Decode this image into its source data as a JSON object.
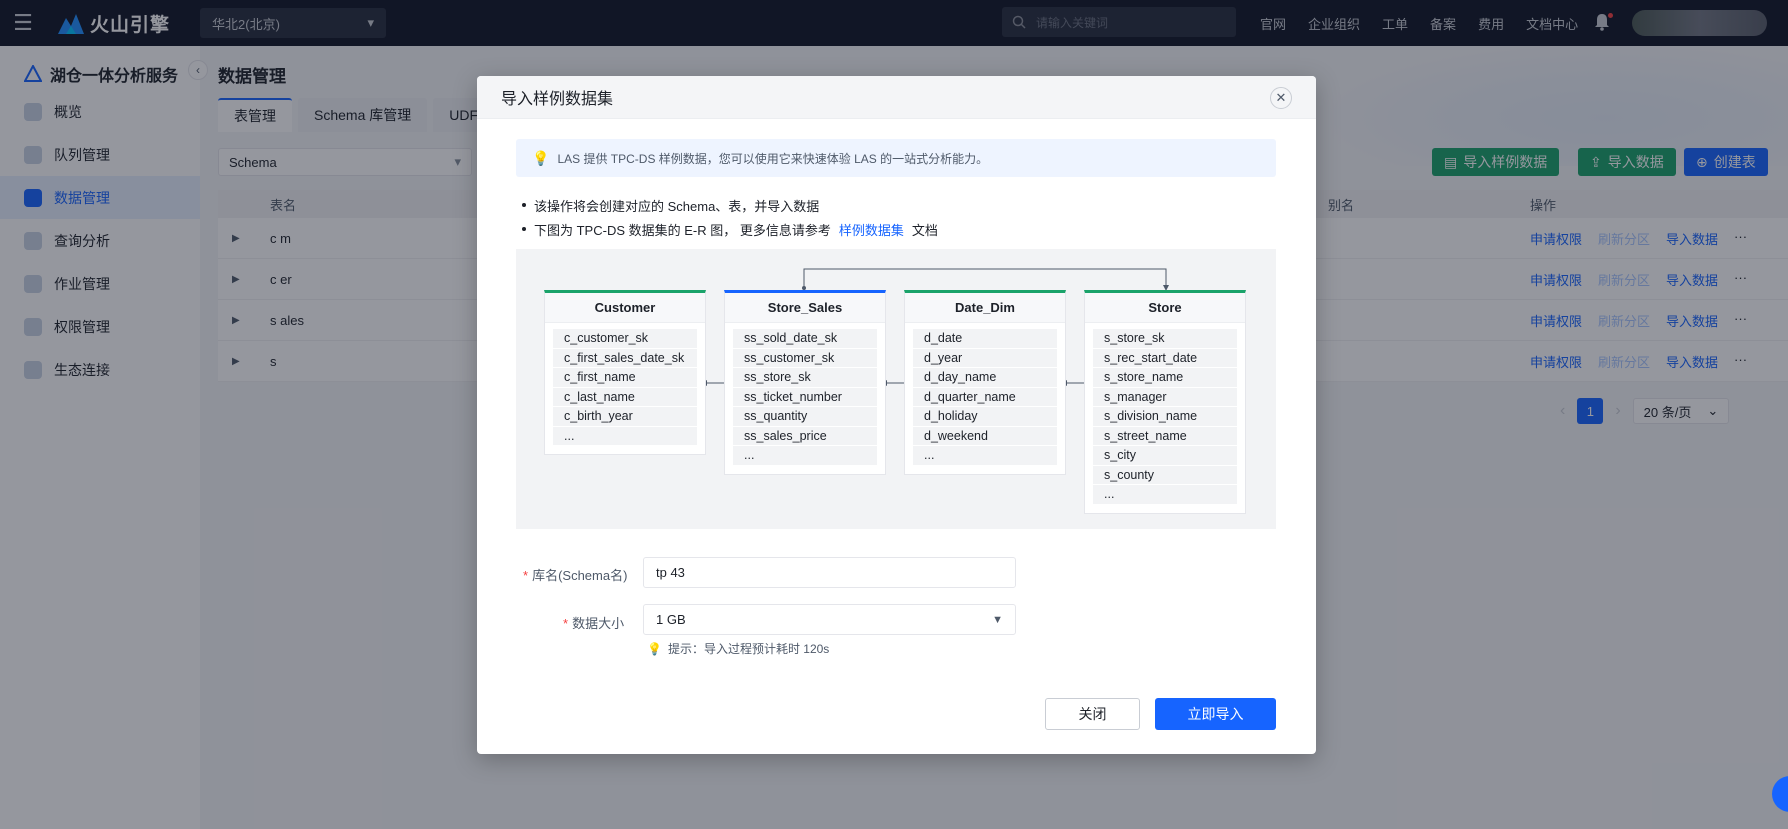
{
  "topbar": {
    "brand": "火山引擎",
    "region": "华北2(北京)",
    "search_placeholder": "请输入关键词",
    "links": [
      "官网",
      "企业组织",
      "工单",
      "备案",
      "费用",
      "文档中心"
    ]
  },
  "sidebar": {
    "title": "湖仓一体分析服务",
    "items": [
      {
        "label": "概览"
      },
      {
        "label": "队列管理"
      },
      {
        "label": "数据管理"
      },
      {
        "label": "查询分析"
      },
      {
        "label": "作业管理"
      },
      {
        "label": "权限管理"
      },
      {
        "label": "生态连接"
      }
    ]
  },
  "main": {
    "page_title": "数据管理",
    "tabs": [
      "表管理",
      "Schema 库管理",
      "UDF"
    ],
    "filter_label": "Schema",
    "buttons": {
      "import_sample": "导入样例数据",
      "import_data": "导入数据",
      "create_table": "创建表"
    },
    "table": {
      "col_name": "表名",
      "col_alias": "别名",
      "col_ops": "操作",
      "rows": [
        {
          "name": "c      m"
        },
        {
          "name": "c     er"
        },
        {
          "name": "s      ales"
        },
        {
          "name": "s"
        }
      ],
      "op_request": "申请权限",
      "op_refresh": "刷新分区",
      "op_import": "导入数据",
      "op_more": "···"
    },
    "pager": {
      "current": "1",
      "prev": "‹",
      "next": "›",
      "page_size": "20 条/页"
    }
  },
  "modal": {
    "title": "导入样例数据集",
    "tip": "LAS 提供 TPC-DS 样例数据，您可以使用它来快速体验 LAS 的一站式分析能力。",
    "bullet1": "该操作将会创建对应的 Schema、表，并导入数据",
    "bullet2_prefix": "下图为 TPC-DS 数据集的 E-R 图， 更多信息请参考",
    "bullet2_link": "样例数据集",
    "bullet2_suffix": "文档",
    "er": {
      "customer": {
        "title": "Customer",
        "fields": [
          "c_customer_sk",
          "c_first_sales_date_sk",
          "c_first_name",
          "c_last_name",
          "c_birth_year",
          "..."
        ]
      },
      "store_sales": {
        "title": "Store_Sales",
        "fields": [
          "ss_sold_date_sk",
          "ss_customer_sk",
          "ss_store_sk",
          "ss_ticket_number",
          "ss_quantity",
          "ss_sales_price",
          "..."
        ]
      },
      "date_dim": {
        "title": "Date_Dim",
        "fields": [
          "d_date",
          "d_year",
          "d_day_name",
          "d_quarter_name",
          "d_holiday",
          "d_weekend",
          "..."
        ]
      },
      "store": {
        "title": "Store",
        "fields": [
          "s_store_sk",
          "s_rec_start_date",
          "s_store_name",
          "s_manager",
          "s_division_name",
          "s_street_name",
          "s_city",
          "s_county",
          "..."
        ]
      }
    },
    "form": {
      "schema_label": "库名(Schema名)",
      "schema_value": "tp                         43",
      "size_label": "数据大小",
      "size_value": "1 GB",
      "hint": "提示：导入过程预计耗时 120s"
    },
    "btn_close": "关闭",
    "btn_import": "立即导入"
  }
}
